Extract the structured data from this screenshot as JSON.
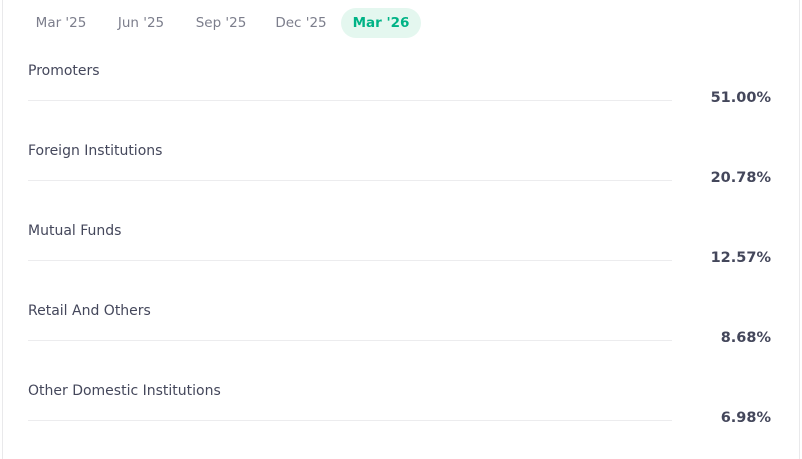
{
  "tabs": [
    {
      "label": "Mar '25",
      "active": false
    },
    {
      "label": "Jun '25",
      "active": false
    },
    {
      "label": "Sep '25",
      "active": false
    },
    {
      "label": "Dec '25",
      "active": false
    },
    {
      "label": "Mar '26",
      "active": true
    }
  ],
  "holdings": [
    {
      "label": "Promoters",
      "value": "51.00%",
      "percent": 51.0
    },
    {
      "label": "Foreign Institutions",
      "value": "20.78%",
      "percent": 20.78
    },
    {
      "label": "Mutual Funds",
      "value": "12.57%",
      "percent": 12.57
    },
    {
      "label": "Retail And Others",
      "value": "8.68%",
      "percent": 8.68
    },
    {
      "label": "Other Domestic Institutions",
      "value": "6.98%",
      "percent": 6.98
    }
  ],
  "colors": {
    "accent": "#00b386",
    "accent_bg": "#e4f7ef",
    "text": "#44475b",
    "muted": "#7c7e8c",
    "track": "#ececee"
  }
}
